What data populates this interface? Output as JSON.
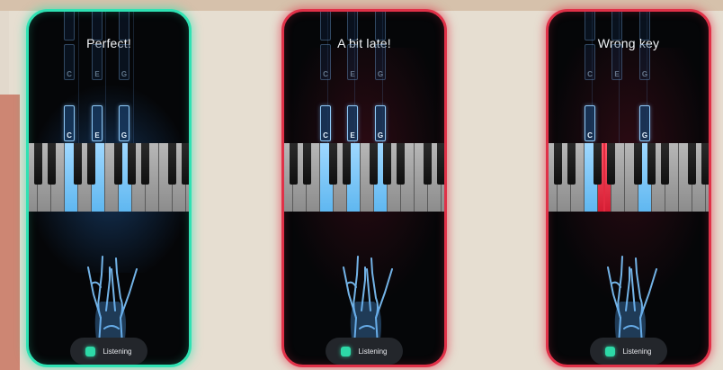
{
  "colors": {
    "perfect_frame": "#2fe2b3",
    "error_frame": "#e03148",
    "lit_key": "#6fc1f3",
    "wrong_key": "#e32a40",
    "listening_dot": "#2dd9a7"
  },
  "screens": [
    {
      "feedback": "Perfect!",
      "frame": "perfect",
      "top_notes": [
        "C",
        "E",
        "G"
      ],
      "main_notes": [
        "C",
        "E",
        "G"
      ],
      "lit_keys": [
        "C",
        "E",
        "G"
      ],
      "wrong_keys": [],
      "listening_label": "Listening",
      "icon": "mic-icon"
    },
    {
      "feedback": "A bit late!",
      "frame": "error",
      "top_notes": [
        "C",
        "E",
        "G"
      ],
      "main_notes": [
        "C",
        "E",
        "G"
      ],
      "lit_keys": [
        "C",
        "E",
        "G"
      ],
      "wrong_keys": [],
      "listening_label": "Listening",
      "icon": "mic-icon"
    },
    {
      "feedback": "Wrong key",
      "frame": "error",
      "top_notes": [
        "C",
        "E",
        "G"
      ],
      "main_notes": [
        "C",
        "G"
      ],
      "lit_keys": [
        "C",
        "G"
      ],
      "wrong_keys": [
        "D"
      ],
      "listening_label": "Listening",
      "icon": "mic-icon"
    }
  ]
}
